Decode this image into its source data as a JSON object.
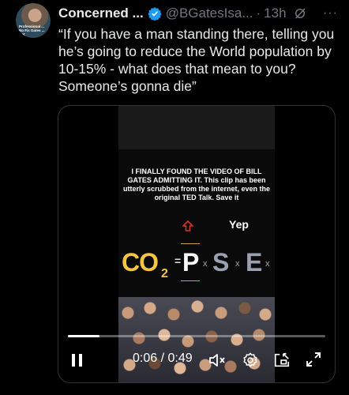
{
  "post": {
    "author_name": "Concerned ...",
    "handle": "@BGatesIsa...",
    "separator": "·",
    "time": "13h",
    "more_label": "···",
    "text": "“If you have a man standing there, telling you he’s going to reduce the World population by 10-15% - what does that mean to you? Someone’s gonna die”"
  },
  "avatar_overlay_text": "Professional ... No Fix Gates ... Not",
  "video": {
    "caption": "I FINALLY FOUND THE VIDEO OF BILL GATES ADMITTING IT. This clip has been utterly scrubbed from the internet, even the original TED Talk. Save it",
    "yep_label": "Yep",
    "formula": {
      "co": "CO",
      "sub": "2",
      "eq": "=",
      "p": "P",
      "x": "x",
      "s": "S",
      "e": "E"
    },
    "progress": 0.122,
    "current_time": "0:06",
    "duration": "0:49",
    "time_separator": " / "
  },
  "colors": {
    "background": "#000000",
    "verified": "#1d9bf0",
    "muted_text": "#71767b",
    "formula_gold": "#f5c542"
  },
  "icons": [
    "verified-badge-icon",
    "grok-icon",
    "more-icon",
    "pause-icon",
    "mute-icon",
    "settings-icon",
    "picture-in-picture-icon",
    "fullscreen-icon"
  ]
}
